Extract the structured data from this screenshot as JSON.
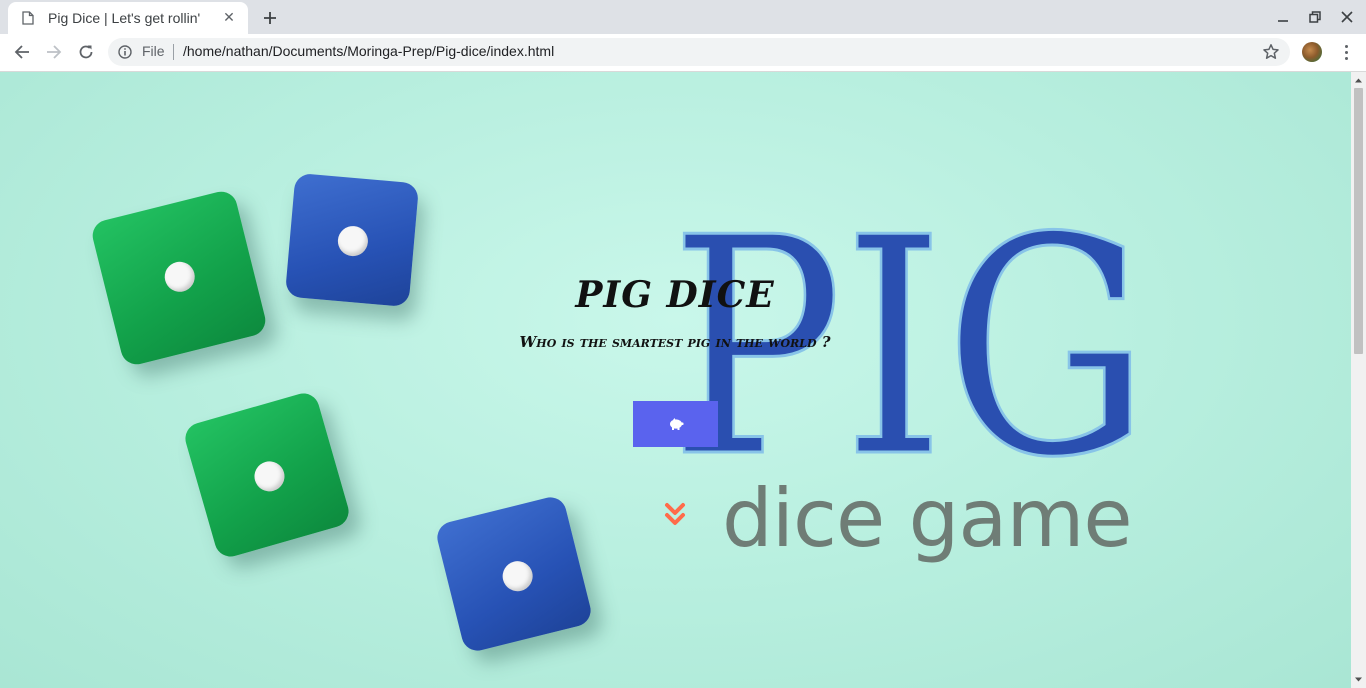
{
  "browser": {
    "tab_title": "Pig Dice | Let's get rollin'",
    "tab_close": "✕",
    "new_tab": "+",
    "omnibox": {
      "scheme_label": "File",
      "url": "/home/nathan/Documents/Moringa-Prep/Pig-dice/index.html"
    }
  },
  "page": {
    "title": "PIG DICE",
    "subtitle": "Who is the smartest pig in the world ?",
    "background_art": {
      "big_word": "PIG",
      "tagline": "dice game"
    },
    "play_button_icon": "piggy-bank-icon",
    "scroll_hint_icon": "double-chevron-down-icon"
  },
  "colors": {
    "play_button": "#5a63ee",
    "scroll_hint": "#ff6b4a",
    "pig_letters": "#2a4fb0",
    "background": "#c4f3e6"
  }
}
